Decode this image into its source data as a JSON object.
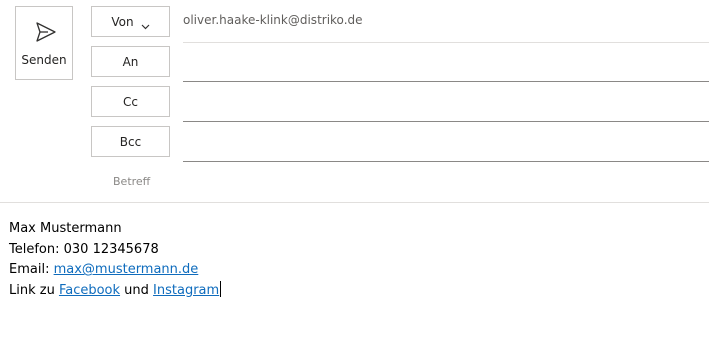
{
  "actions": {
    "send_label": "Senden"
  },
  "fields": {
    "from_label": "Von",
    "from_value": "oliver.haake-klink@distriko.de",
    "to_label": "An",
    "cc_label": "Cc",
    "bcc_label": "Bcc",
    "subject_label": "Betreff"
  },
  "signature": {
    "name": "Max Mustermann",
    "phone_line": "Telefon: 030 12345678",
    "email_prefix": "Email: ",
    "email_link": "max@mustermann.de",
    "links_prefix": "Link zu ",
    "facebook_link": "Facebook",
    "links_join": " und ",
    "instagram_link": "Instagram"
  },
  "colors": {
    "link": "#0f6cbd",
    "border": "#c8c6c4"
  },
  "icons": {
    "send": "send-icon",
    "from_dropdown": "chevron-down-icon"
  }
}
